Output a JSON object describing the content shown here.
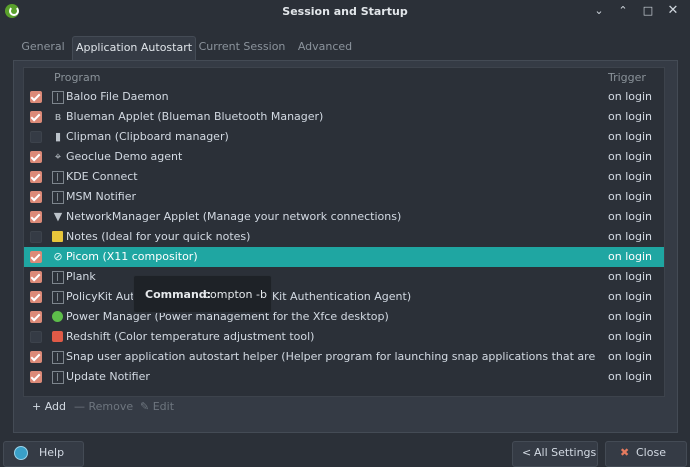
{
  "window": {
    "title": "Session and Startup",
    "app_icon": "xfce-session-icon",
    "controls": [
      "chevron-down-icon",
      "chevron-up-icon",
      "minimize-icon",
      "maximize-icon",
      "close-icon"
    ]
  },
  "tabs": [
    {
      "label": "General",
      "active": false
    },
    {
      "label": "Application Autostart",
      "active": true
    },
    {
      "label": "Current Session",
      "active": false
    },
    {
      "label": "Advanced",
      "active": false
    }
  ],
  "table": {
    "columns": [
      "Program",
      "Trigger"
    ],
    "rows": [
      {
        "checked": true,
        "icon": "generic-app-icon",
        "name": "Baloo File Daemon",
        "trigger": "on login",
        "selected": false
      },
      {
        "checked": true,
        "icon": "bluetooth-icon",
        "name": "Blueman Applet (Blueman Bluetooth Manager)",
        "trigger": "on login",
        "selected": false
      },
      {
        "checked": false,
        "icon": "clipboard-icon",
        "name": "Clipman (Clipboard manager)",
        "trigger": "on login",
        "selected": false
      },
      {
        "checked": true,
        "icon": "location-pin-icon",
        "name": "Geoclue Demo agent",
        "trigger": "on login",
        "selected": false
      },
      {
        "checked": true,
        "icon": "generic-app-icon",
        "name": "KDE Connect",
        "trigger": "on login",
        "selected": false
      },
      {
        "checked": true,
        "icon": "generic-app-icon",
        "name": "MSM Notifier",
        "trigger": "on login",
        "selected": false
      },
      {
        "checked": true,
        "icon": "wifi-icon",
        "name": "NetworkManager Applet (Manage your network connections)",
        "trigger": "on login",
        "selected": false
      },
      {
        "checked": false,
        "icon": "notes-icon",
        "name": "Notes (Ideal for your quick notes)",
        "trigger": "on login",
        "selected": false
      },
      {
        "checked": true,
        "icon": "no-entry-icon",
        "name": "Picom (X11 compositor)",
        "trigger": "on login",
        "selected": true
      },
      {
        "checked": true,
        "icon": "generic-app-icon",
        "name": "Plank",
        "trigger": "on login",
        "selected": false
      },
      {
        "checked": true,
        "icon": "generic-app-icon",
        "name": "PolicyKit Authentication Agent (PolicyKit Authentication Agent)",
        "trigger": "on login",
        "selected": false
      },
      {
        "checked": true,
        "icon": "power-icon",
        "name": "Power Manager (Power management for the Xfce desktop)",
        "trigger": "on login",
        "selected": false
      },
      {
        "checked": false,
        "icon": "redshift-icon",
        "name": "Redshift (Color temperature adjustment tool)",
        "trigger": "on login",
        "selected": false
      },
      {
        "checked": true,
        "icon": "generic-app-icon",
        "name": "Snap user application autostart helper (Helper program for launching snap applications that are configured to start automatically)",
        "trigger": "on login",
        "selected": false
      },
      {
        "checked": true,
        "icon": "generic-app-icon",
        "name": "Update Notifier",
        "trigger": "on login",
        "selected": false
      }
    ]
  },
  "tooltip": {
    "label": "Command:",
    "value": "compton -b"
  },
  "toolbar": {
    "add": "Add",
    "remove": "Remove",
    "edit": "Edit"
  },
  "buttons": {
    "help": "Help",
    "all_settings": "All Settings",
    "close": "Close"
  },
  "colors": {
    "accent": "#1fa6a2",
    "checkbox": "#dc8a78",
    "background": "#2b3038"
  }
}
